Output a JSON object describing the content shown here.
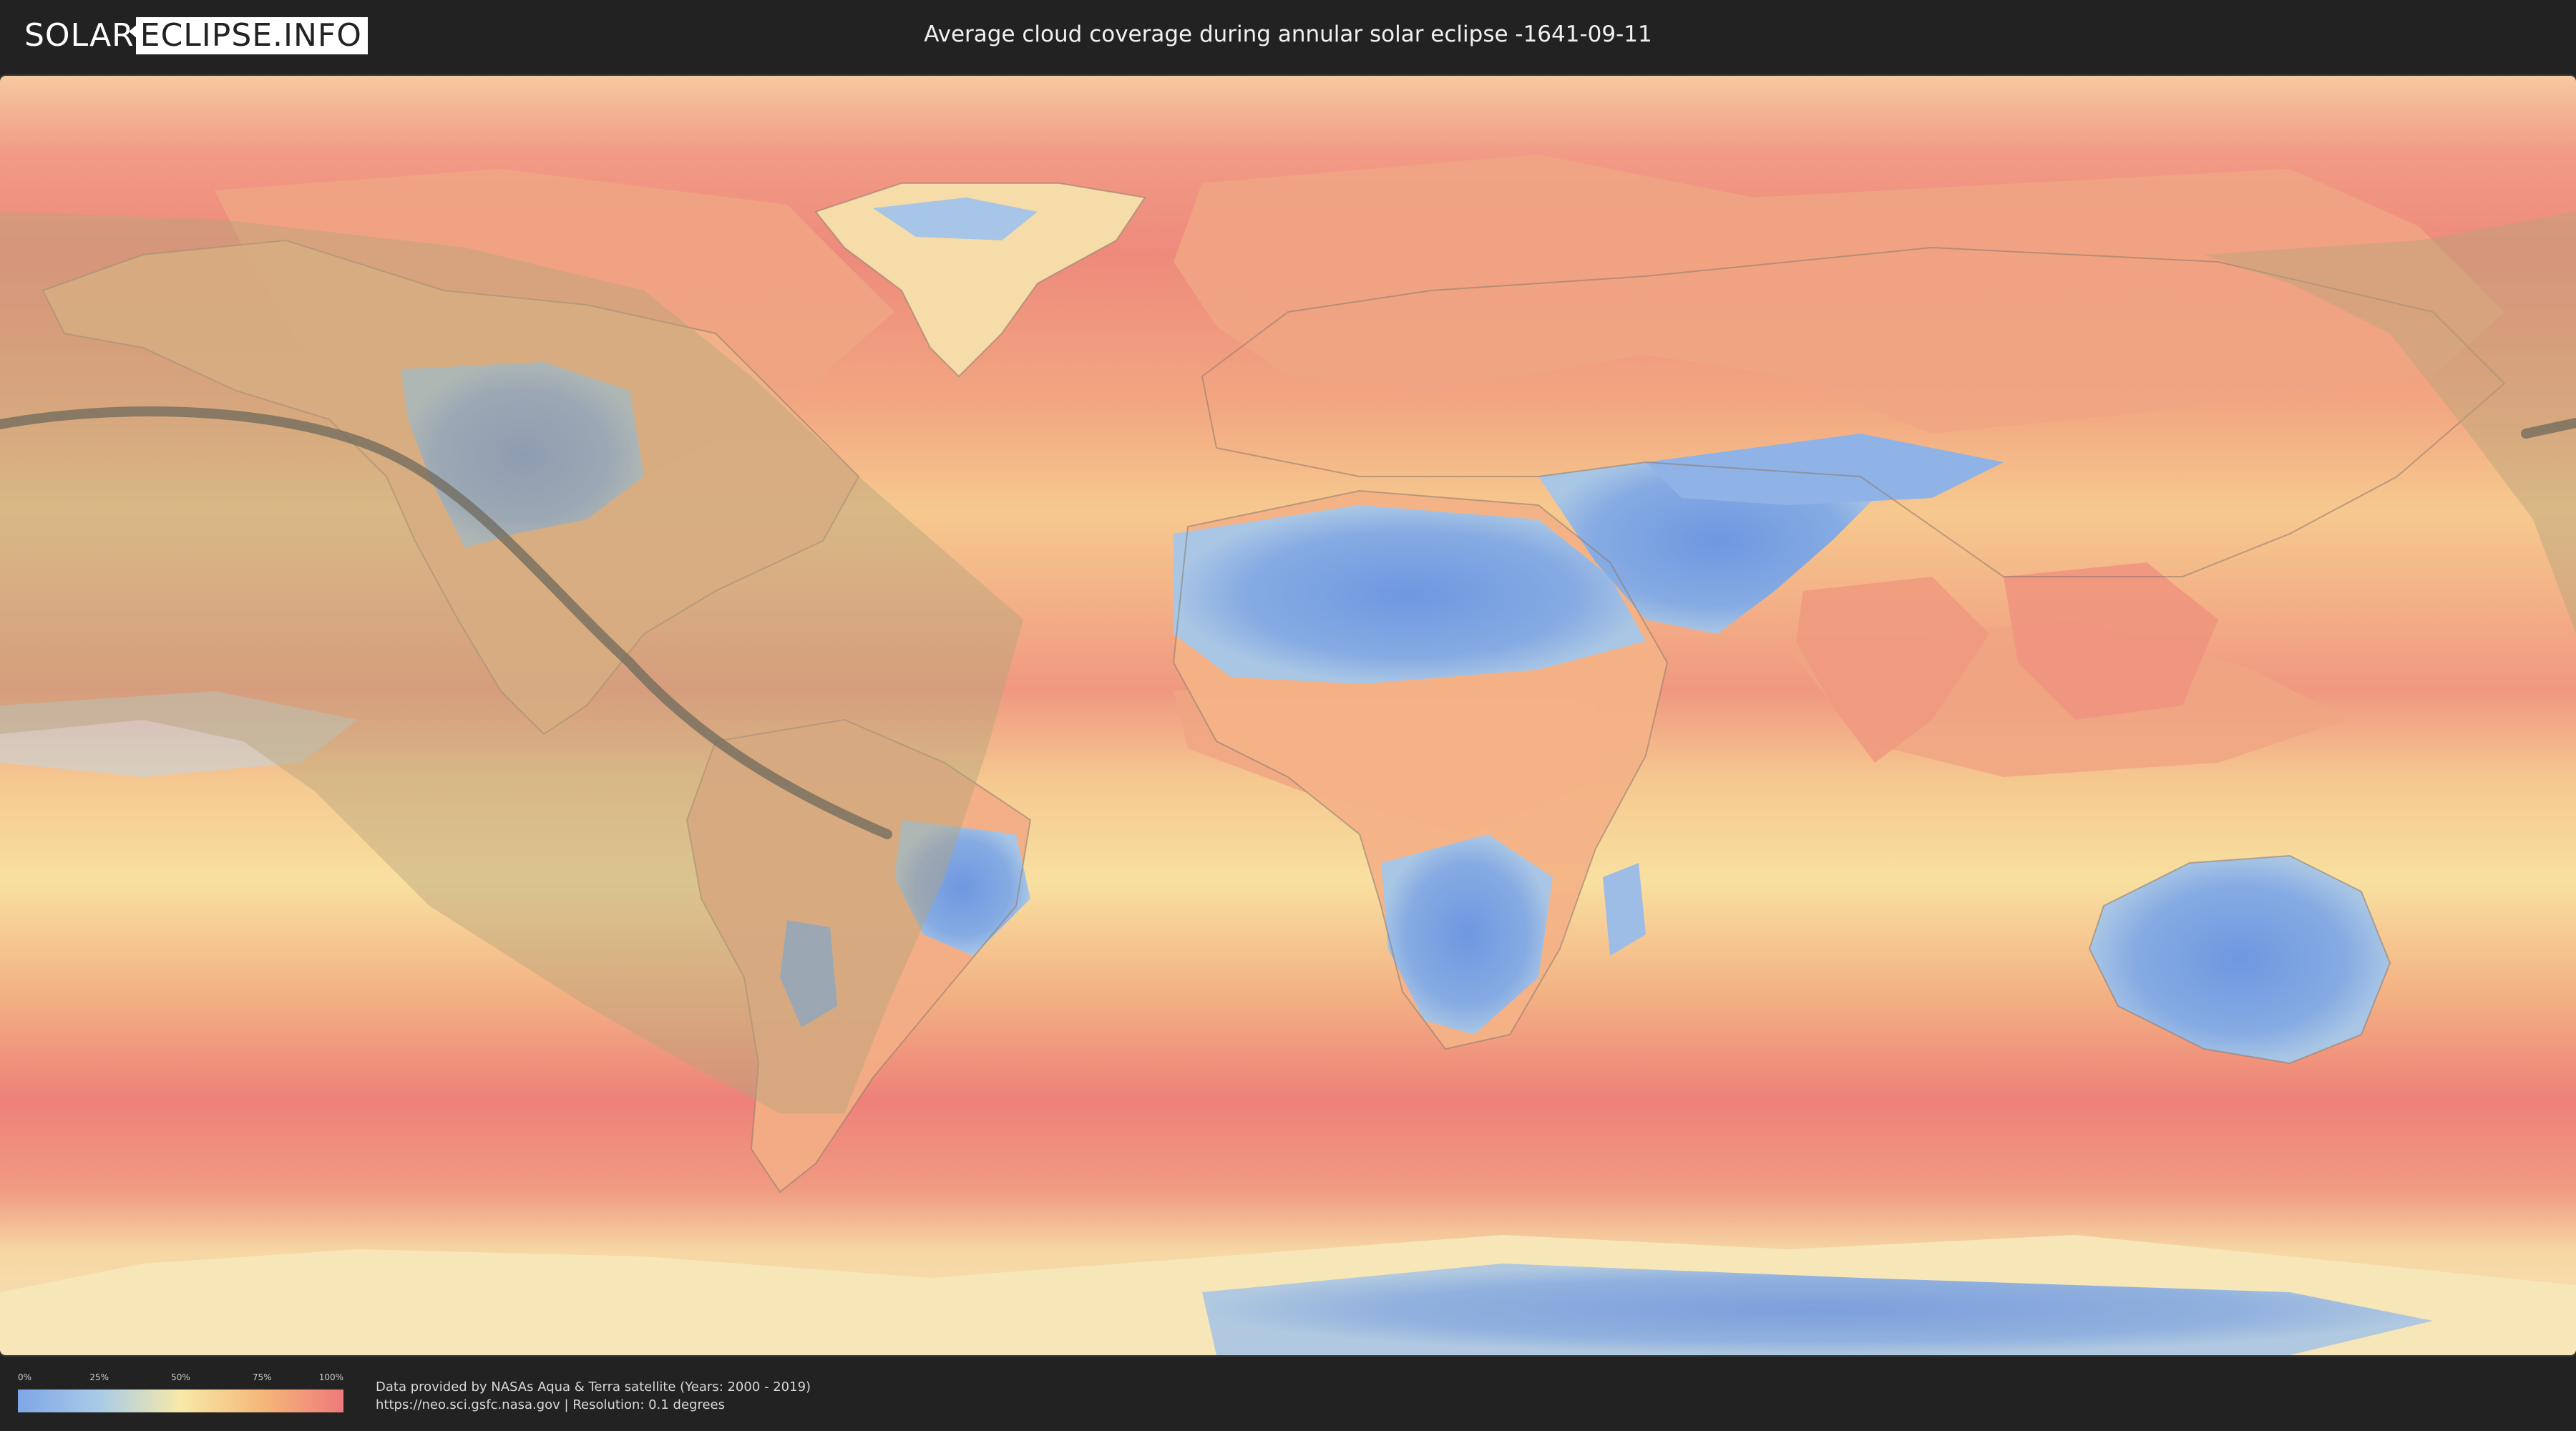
{
  "header": {
    "logo_solar": "SOLAR",
    "logo_eclipse": "ECLIPSE.INFO",
    "title": "Average cloud coverage during annular solar eclipse -1641-09-11"
  },
  "legend": {
    "ticks": [
      "0%",
      "25%",
      "50%",
      "75%",
      "100%"
    ],
    "tick_fractions": [
      0,
      0.25,
      0.5,
      0.75,
      1.0
    ],
    "colors": [
      "#7fa6e6",
      "#a9cbe8",
      "#f7e9a8",
      "#f5b879",
      "#ee7a7a"
    ]
  },
  "footer": {
    "credit_line": "Data provided by NASAs Aqua & Terra satellite (Years: 2000 - 2019)",
    "source_line": "https://neo.sci.gsfc.nasa.gov | Resolution: 0.1 degrees"
  },
  "colors": {
    "background": "#222222",
    "clear_sky": "#7fa6e6",
    "overcast": "#ee7a7a",
    "eclipse_zone": "#b5a57a",
    "central_line": "#6e6a5c"
  }
}
